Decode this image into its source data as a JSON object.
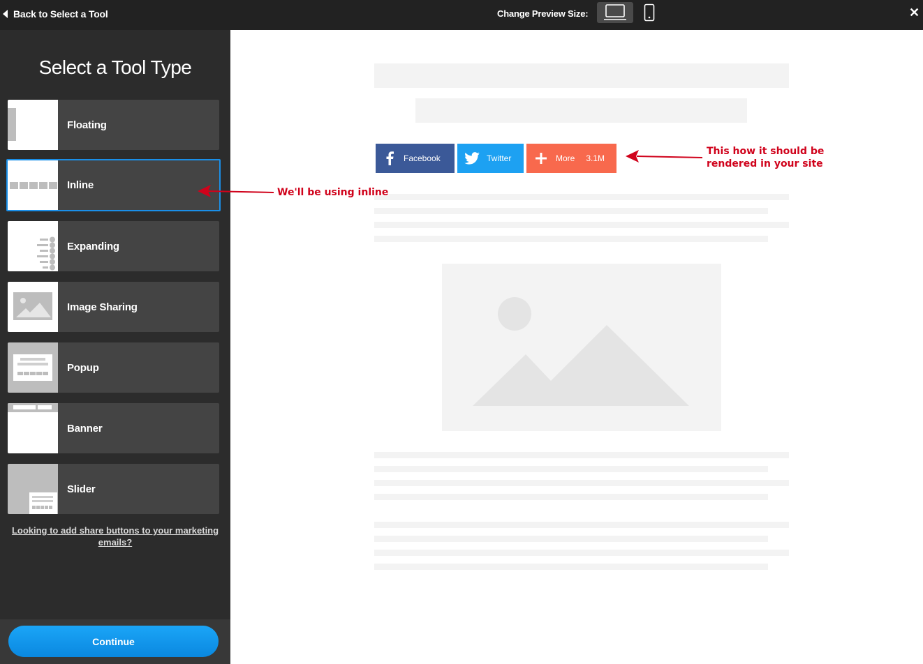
{
  "topbar": {
    "back_label": "Back to Select a Tool",
    "preview_label": "Change Preview Size:",
    "close_label": "✕"
  },
  "sidebar": {
    "title": "Select a Tool Type",
    "items": [
      {
        "label": "Floating",
        "icon": "floating-thumb-icon"
      },
      {
        "label": "Inline",
        "icon": "inline-thumb-icon",
        "selected": true
      },
      {
        "label": "Expanding",
        "icon": "expanding-thumb-icon"
      },
      {
        "label": "Image Sharing",
        "icon": "image-sharing-thumb-icon"
      },
      {
        "label": "Popup",
        "icon": "popup-thumb-icon"
      },
      {
        "label": "Banner",
        "icon": "banner-thumb-icon"
      },
      {
        "label": "Slider",
        "icon": "slider-thumb-icon"
      }
    ],
    "email_link": "Looking to add share buttons to your marketing emails?",
    "continue_label": "Continue"
  },
  "preview": {
    "share_buttons": {
      "facebook": "Facebook",
      "twitter": "Twitter",
      "more": "More",
      "count": "3.1M"
    }
  },
  "annotations": {
    "inline_note": "We'll be using inline",
    "render_note_line1": "This how it should be",
    "render_note_line2": "rendered in your site"
  },
  "colors": {
    "accent": "#1a8fe8",
    "facebook": "#3b5998",
    "twitter": "#1da1f2",
    "more": "#f8694d",
    "annotation": "#d0021b"
  }
}
